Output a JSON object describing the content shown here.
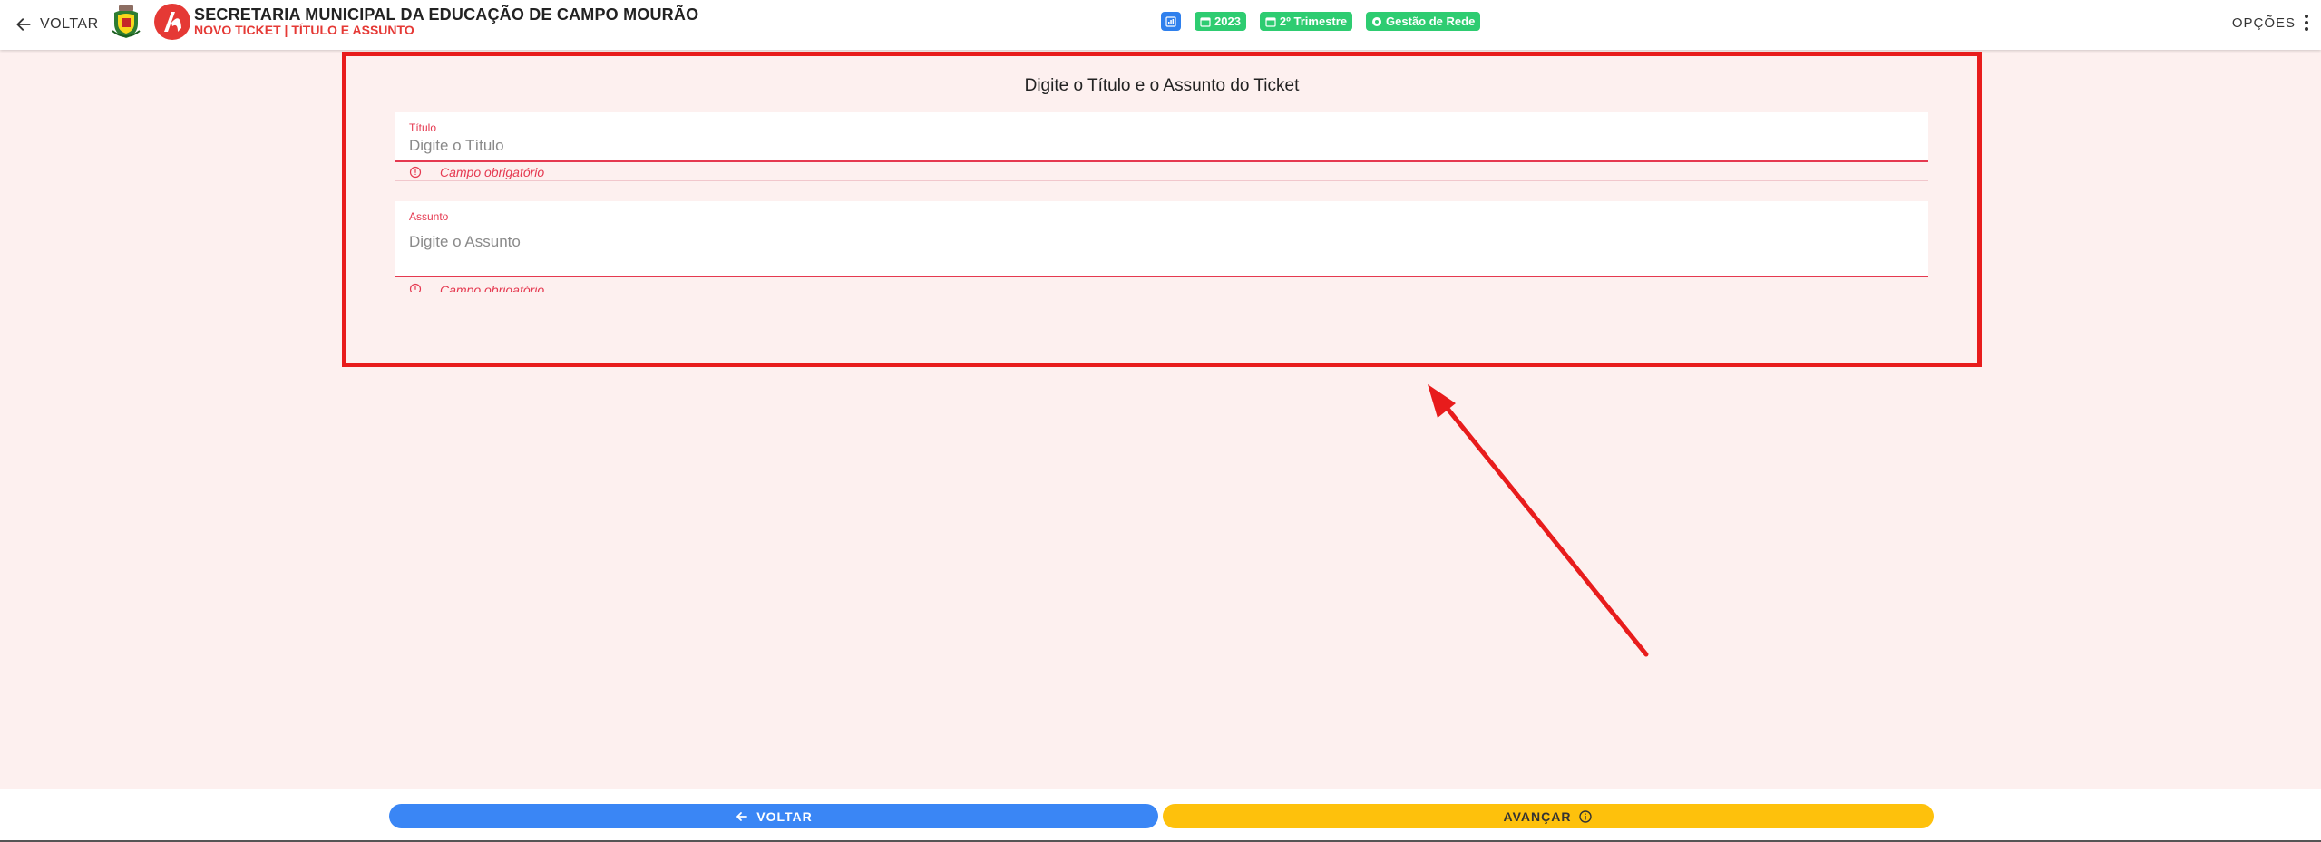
{
  "header": {
    "back_label": "VOLTAR",
    "org_title": "SECRETARIA MUNICIPAL DA EDUCAÇÃO DE CAMPO MOURÃO",
    "org_subtitle": "NOVO TICKET | TÍTULO E ASSUNTO",
    "chips": {
      "year": "2023",
      "term": "2º Trimestre",
      "area": "Gestão de Rede"
    },
    "options_label": "OPÇÕES"
  },
  "form": {
    "heading": "Digite o Título e o Assunto do Ticket",
    "titulo": {
      "label": "Título",
      "placeholder": "Digite o Título",
      "value": "",
      "error": "Campo obrigatório"
    },
    "assunto": {
      "label": "Assunto",
      "placeholder": "Digite o Assunto",
      "value": "",
      "error": "Campo obrigatório"
    }
  },
  "footer": {
    "back_button": "VOLTAR",
    "next_button": "AVANÇAR"
  },
  "colors": {
    "accent_blue": "#3a86f5",
    "accent_yellow": "#fec10c",
    "error_red": "#e53950",
    "chip_green": "#2ecc71",
    "annotation_red": "#e81c1c"
  }
}
